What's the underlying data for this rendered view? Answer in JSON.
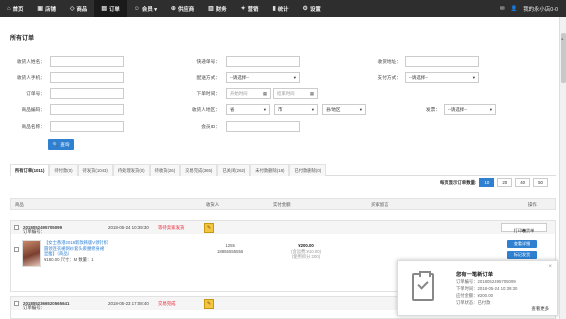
{
  "nav": {
    "items": [
      {
        "icon": "home-icon",
        "glyph": "⌂",
        "label": "首页",
        "active": false
      },
      {
        "icon": "store-icon",
        "glyph": "▣",
        "label": "店铺",
        "active": false
      },
      {
        "icon": "tag-icon",
        "glyph": "◇",
        "label": "商品",
        "active": false
      },
      {
        "icon": "order-icon",
        "glyph": "▤",
        "label": "订单",
        "active": true
      },
      {
        "icon": "user-icon",
        "glyph": "☺",
        "label": "会员 ▾",
        "active": false
      },
      {
        "icon": "supplier-icon",
        "glyph": "⊕",
        "label": "供应商",
        "active": false
      },
      {
        "icon": "finance-icon",
        "glyph": "▥",
        "label": "财务",
        "active": false
      },
      {
        "icon": "marketing-icon",
        "glyph": "✦",
        "label": "营销",
        "active": false
      },
      {
        "icon": "stats-icon",
        "glyph": "▮",
        "label": "统计",
        "active": false
      },
      {
        "icon": "settings-icon",
        "glyph": "⚙",
        "label": "设置",
        "active": false
      }
    ],
    "mail_glyph": "✉",
    "user_label": "我的永小店0-0"
  },
  "page_title": "所有订单",
  "filters": {
    "receiver_name": "收货人姓名：",
    "receiver_phone": "收货人手机：",
    "order_no": "订单号：",
    "goods_no": "商品编码：",
    "goods_name": "商品名称：",
    "express_no": "快递单号：",
    "delivery_method": "配送方式：",
    "order_time": "下单时间：",
    "receiver_area": "收货人地区：",
    "member_id": "会员ID：",
    "receiver_address": "收货地址：",
    "pay_method": "支付方式：",
    "invoice": "发票：",
    "select_placeholder": "--请选择--",
    "start_time": "开始时间",
    "end_time": "结束时间",
    "province": "省",
    "city": "市",
    "district": "县/地区",
    "query_button": "查询"
  },
  "tabs": [
    "所有订单(1011)",
    "待付款(0)",
    "待发货(1043)",
    "待处理发货(0)",
    "待收货(26)",
    "交易完成(365)",
    "已关闭(262)",
    "未付款删除(18)",
    "已付款删除(0)"
  ],
  "pager": {
    "label": "每页显示订单数量:",
    "options": [
      "10",
      "20",
      "40",
      "50"
    ],
    "active": "10"
  },
  "table_headers": [
    "商品",
    "收货人",
    "实付金额",
    "买家留言",
    "操作"
  ],
  "orders": [
    {
      "order_no_label": "订单编号：",
      "order_no": "2018052495705099",
      "time": "2018-05-24 10:39:30",
      "status": "等待卖家发货",
      "goods_title_1": "【女士香港2018新款韩版V领针织",
      "goods_title_2": "圆领连衣裙网纱套头裹腰修身裙",
      "goods_title_3": "显瘦】（商品）",
      "goods_price": "¥180.00 尺寸：M 数量：1",
      "receiver_1": "1255",
      "receiver_2": "18855555555",
      "amount": "¥200.00",
      "amount_detail_1": "(含运费:¥10.00)",
      "amount_detail_2": "(使用积分:200)",
      "print_btn": "打印发货单",
      "view_btn": "查看详细",
      "remark_btn": "标记发货"
    },
    {
      "order_no_label": "订单编号：",
      "order_no": "2018052366520565641",
      "time": "2018-05-23 17:08:40",
      "status": "交易完成"
    }
  ],
  "notification": {
    "title": "您有一笔新订单",
    "line1": "订单编号：2018052495705099",
    "line2": "下单时间：2018-05-24 10:39:30",
    "line3": "应付金额：¥200.00",
    "line4": "订单状态：已付款",
    "more": "查看更多",
    "close_glyph": "×"
  }
}
